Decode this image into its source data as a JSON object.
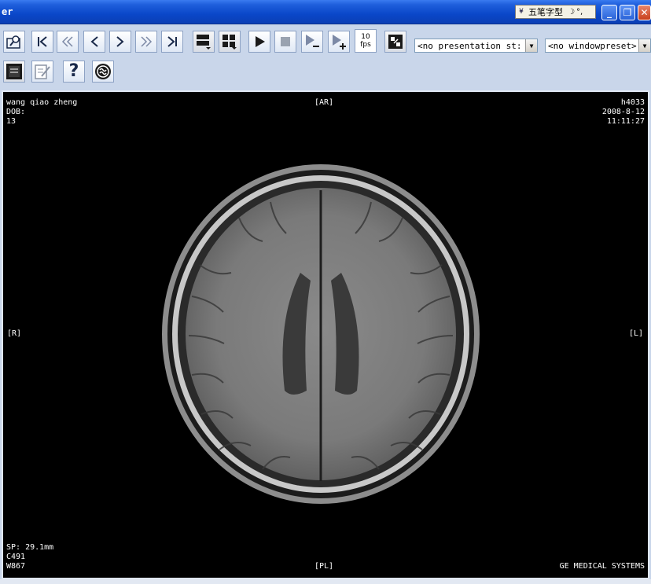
{
  "window": {
    "title": "er",
    "ime": {
      "label": "五笔字型",
      "arrow": "¥",
      "moon": "☽",
      "dots": "°,"
    },
    "buttons": {
      "minimize": "_",
      "maximize": "❐",
      "close": "✕"
    }
  },
  "toolbar": {
    "fps_value": "10",
    "fps_unit": "fps",
    "presentation_select": "<no presentation st:",
    "window_preset_select": "<no windowpreset>"
  },
  "overlay": {
    "patient_name": "wang qiao zheng",
    "dob_label": "DOB:",
    "image_number": "13",
    "orientation_top": "[AR]",
    "orientation_bottom": "[PL]",
    "orientation_left": "[R]",
    "orientation_right": "[L]",
    "study_id": "h4033",
    "study_date": "2008-8-12",
    "study_time": "11:11:27",
    "slice_position": "SP: 29.1mm",
    "window_center": "C491",
    "window_width": "W867",
    "manufacturer": "GE MEDICAL SYSTEMS"
  }
}
